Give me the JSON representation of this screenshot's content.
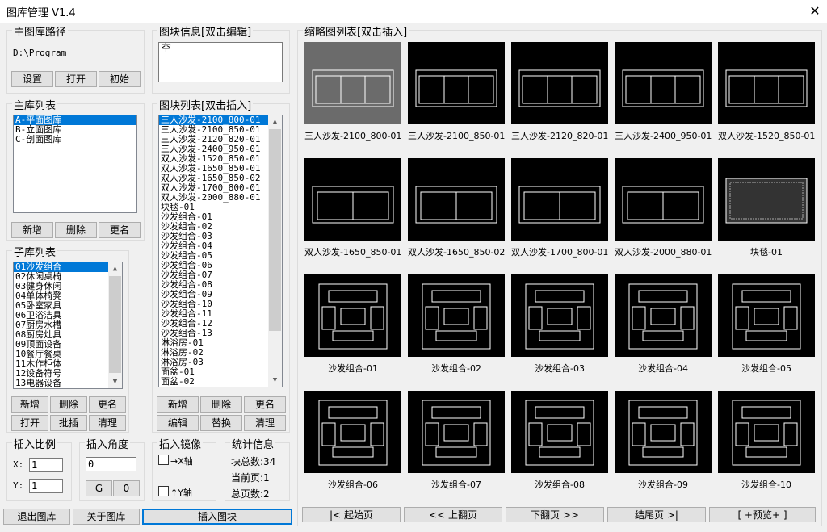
{
  "window": {
    "title": "图库管理 V1.4",
    "close": "✕"
  },
  "main_path": {
    "legend": "主图库路径",
    "path": "D:\\Program",
    "buttons": [
      "设置",
      "打开",
      "初始"
    ]
  },
  "block_info": {
    "legend": "图块信息[双击编辑]",
    "value": "空"
  },
  "main_lib": {
    "legend": "主库列表",
    "items": [
      "A-平面图库",
      "B-立面图库",
      "C-剖面图库"
    ],
    "buttons": [
      "新增",
      "删除",
      "更名"
    ]
  },
  "sub_lib": {
    "legend": "子库列表",
    "items": [
      "01沙发组合",
      "02休闲桌椅",
      "03健身休闲",
      "04单体椅凳",
      "05卧室家具",
      "06卫浴洁具",
      "07厨房水槽",
      "08厨房灶具",
      "09顶面设备",
      "10餐厅餐桌",
      "11木作柜体",
      "12设备符号",
      "13电器设备"
    ],
    "buttons": [
      "新增",
      "删除",
      "更名",
      "打开",
      "批插",
      "清理"
    ]
  },
  "block_list": {
    "legend": "图块列表[双击插入]",
    "items": [
      "三人沙发-2100_800-01",
      "三人沙发-2100_850-01",
      "三人沙发-2120_820-01",
      "三人沙发-2400_950-01",
      "双人沙发-1520_850-01",
      "双人沙发-1650_850-01",
      "双人沙发-1650_850-02",
      "双人沙发-1700_800-01",
      "双人沙发-2000_880-01",
      "块毯-01",
      "沙发组合-01",
      "沙发组合-02",
      "沙发组合-03",
      "沙发组合-04",
      "沙发组合-05",
      "沙发组合-06",
      "沙发组合-07",
      "沙发组合-08",
      "沙发组合-09",
      "沙发组合-10",
      "沙发组合-11",
      "沙发组合-12",
      "沙发组合-13",
      "淋浴房-01",
      "淋浴房-02",
      "淋浴房-03",
      "面盆-01",
      "面盆-02"
    ],
    "buttons": [
      "新增",
      "删除",
      "更名",
      "编辑",
      "替换",
      "清理"
    ]
  },
  "scale": {
    "legend": "插入比例",
    "x_label": "X:",
    "x": "1",
    "y_label": "Y:",
    "y": "1"
  },
  "angle": {
    "legend": "插入角度",
    "value": "0",
    "buttons": [
      "G",
      "0"
    ]
  },
  "mirror": {
    "legend": "插入镜像",
    "x_label": "→X轴",
    "y_label": "↑Y轴"
  },
  "stats": {
    "legend": "统计信息",
    "total": "块总数:34",
    "current": "当前页:1",
    "pages": "总页数:2"
  },
  "bottom": {
    "exit": "退出图库",
    "about": "关于图库",
    "insert": "插入图块"
  },
  "thumbs": {
    "legend": "缩略图列表[双击插入]",
    "items": [
      "三人沙发-2100_800-01",
      "三人沙发-2100_850-01",
      "三人沙发-2120_820-01",
      "三人沙发-2400_950-01",
      "双人沙发-1520_850-01",
      "双人沙发-1650_850-01",
      "双人沙发-1650_850-02",
      "双人沙发-1700_800-01",
      "双人沙发-2000_880-01",
      "块毯-01",
      "沙发组合-01",
      "沙发组合-02",
      "沙发组合-03",
      "沙发组合-04",
      "沙发组合-05",
      "沙发组合-06",
      "沙发组合-07",
      "沙发组合-08",
      "沙发组合-09",
      "沙发组合-10"
    ]
  },
  "pager": [
    "|< 起始页",
    "<< 上翻页",
    "下翻页 >>",
    "结尾页 >|",
    "[ +预览+ ]"
  ]
}
